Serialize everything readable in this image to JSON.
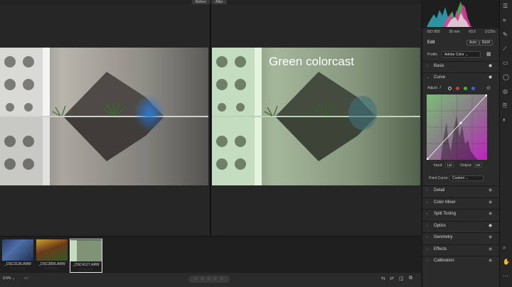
{
  "compare": {
    "before_label": "Before",
    "after_label": "After",
    "overlay_text": "Green colorcast"
  },
  "filmstrip": [
    {
      "name": "_DSC3136.ARW",
      "stars": "☆☆☆☆☆"
    },
    {
      "name": "_DSC3896.ARW",
      "stars": "☆☆☆☆☆"
    },
    {
      "name": "_DSC4127.ARW",
      "stars": "☆☆☆☆☆",
      "selected": true
    }
  ],
  "bottom": {
    "zoom": "9.6% ⌄",
    "rating": "☆ ☆ ☆ ☆ ☆"
  },
  "panel": {
    "exif": [
      "ISO 800",
      "35 mm",
      "f/3.5",
      "1/125s"
    ],
    "edit_title": "Edit",
    "auto_label": "Auto",
    "bw_label": "B&W",
    "profile_label": "Profile",
    "profile_value": "Adobe Color ⌄",
    "sections_top": [
      {
        "label": "Basic"
      },
      {
        "label": "Curve"
      }
    ],
    "adjust_label": "Adjust",
    "input_label": "Input:",
    "input_value": "128",
    "output_label": "Output:",
    "output_value": "139",
    "point_curve_label": "Point Curve:",
    "point_curve_value": "Custom ⌄",
    "sections_bottom": [
      {
        "label": "Detail"
      },
      {
        "label": "Color Mixer"
      },
      {
        "label": "Split Toning"
      },
      {
        "label": "Optics"
      },
      {
        "label": "Geometry"
      },
      {
        "label": "Effects"
      },
      {
        "label": "Calibration"
      }
    ]
  },
  "colors": {
    "curve_green": "#7dbd78",
    "curve_magenta": "#c020c0",
    "cast_tint": "#9fd6a0"
  }
}
